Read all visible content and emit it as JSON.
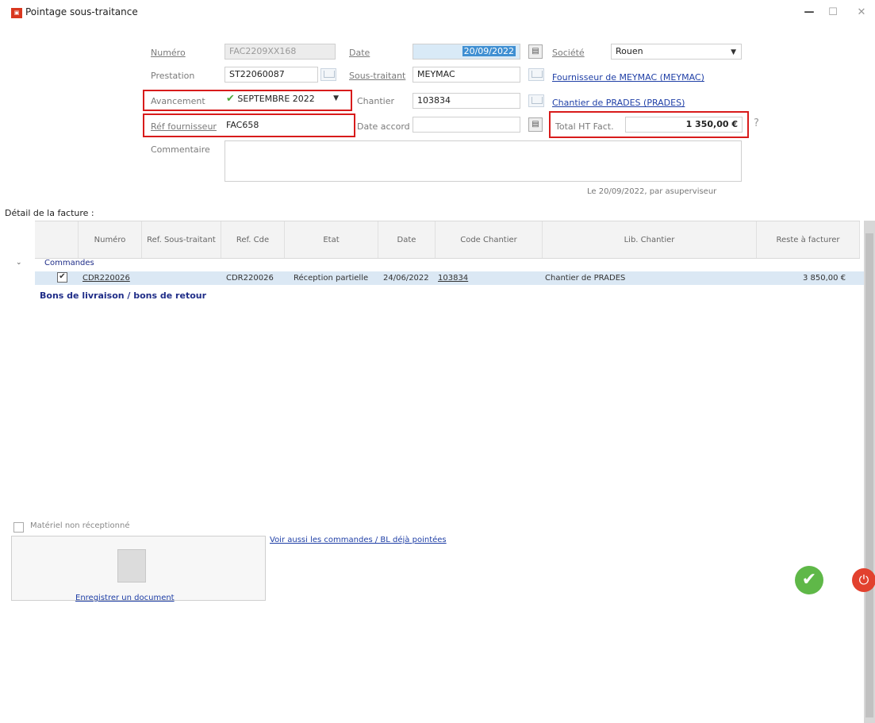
{
  "window": {
    "title": "Pointage sous-traitance",
    "app_icon": "app-icon"
  },
  "form": {
    "numero_label": "Numéro",
    "numero_value": "FAC2209XX168",
    "date_label": "Date",
    "date_value": "20/09/2022",
    "societe_label": "Société",
    "societe_value": "Rouen",
    "prestation_label": "Prestation",
    "prestation_value": "ST22060087",
    "sous_traitant_label": "Sous-traitant",
    "sous_traitant_value": "MEYMAC",
    "fournisseur_link": "Fournisseur de MEYMAC (MEYMAC)",
    "avancement_label": "Avancement",
    "avancement_value": "SEPTEMBRE 2022",
    "chantier_label": "Chantier",
    "chantier_value": "103834",
    "chantier_link": "Chantier de PRADES (PRADES)",
    "ref_fournisseur_label": "Réf fournisseur",
    "ref_fournisseur_value": "FAC658",
    "date_accord_label": "Date accord",
    "date_accord_value": "",
    "total_ht_label": "Total HT Fact.",
    "total_ht_value": "1 350,00 €",
    "commentaire_label": "Commentaire",
    "commentaire_value": "",
    "audit": "Le 20/09/2022, par asuperviseur"
  },
  "detail": {
    "title": "Détail de la facture :",
    "columns": [
      "Numéro",
      "Ref. Sous-traitant",
      "Ref. Cde",
      "Etat",
      "Date",
      "Code Chantier",
      "Lib. Chantier",
      "Reste à facturer"
    ],
    "group_commandes": "Commandes",
    "rows": [
      {
        "numero": "CDR220026",
        "ref_st": "",
        "ref_cde": "CDR220026",
        "etat": "Réception partielle",
        "date": "24/06/2022",
        "code_chantier": "103834",
        "lib_chantier": "Chantier de PRADES",
        "reste": "3 850,00 €"
      }
    ],
    "group_bons": "Bons de livraison / bons de retour"
  },
  "footer": {
    "materiel_label": "Matériel non réceptionné",
    "voir_aussi_link": "Voir aussi les commandes / BL déjà pointées",
    "doc_label": "Enregistrer un document"
  },
  "colors": {
    "accent_blue": "#3f8fd2",
    "red_highlight": "#d81b1b",
    "ok_green": "#5fb848"
  }
}
